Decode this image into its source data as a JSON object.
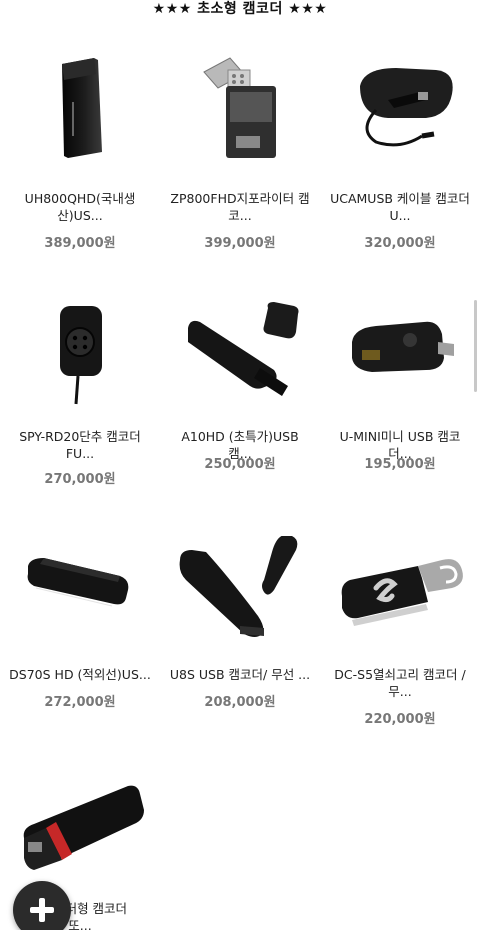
{
  "section": {
    "title": "★★★ 초소형 캠코더 ★★★"
  },
  "products": [
    {
      "name_line1": "UH800QHD(국내생",
      "name_line2": "산)US...",
      "price": "389,000원",
      "image": "flat-black-usb-camcorder"
    },
    {
      "name_line1": "ZP800FHD지포라이터 캠",
      "name_line2": "코...",
      "price": "399,000원",
      "image": "zippo-lighter-camcorder"
    },
    {
      "name_line1": "UCAMUSB 케이블 캠코더",
      "name_line2": "U...",
      "price": "320,000원",
      "image": "usb-cable-camcorder-case"
    },
    {
      "name_line1": "SPY-RD20단추 캠코더",
      "name_line2": "FU...",
      "price": "270,000원",
      "image": "button-camcorder"
    },
    {
      "name_line1": "A10HD (초특가)USB 캠...",
      "name_line2": "",
      "price": "250,000원",
      "image": "usb-stick-camcorder"
    },
    {
      "name_line1": "U-MINI미니 USB 캠코더...",
      "name_line2": "",
      "price": "195,000원",
      "image": "mini-usb-camcorder"
    },
    {
      "name_line1": "DS70S HD (적외선)US...",
      "name_line2": "",
      "price": "272,000원",
      "image": "slim-infrared-camcorder"
    },
    {
      "name_line1": "U8S USB 캠코더/ 무선 ...",
      "name_line2": "",
      "price": "208,000원",
      "image": "wireless-usb-camcorder"
    },
    {
      "name_line1": "DC-S5열쇠고리 캠코더 /",
      "name_line2": "무...",
      "price": "220,000원",
      "image": "keychain-camcorder"
    },
    {
      "name_line1": "D라이터형 캠코더",
      "name_line2": "또...",
      "price": "",
      "image": "lighter-camcorder"
    }
  ],
  "fab": {
    "icon": "plus-icon"
  }
}
